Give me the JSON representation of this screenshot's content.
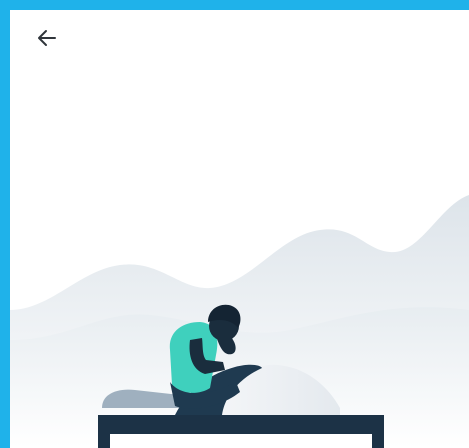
{
  "screen": {
    "frame_color": "#1fb2ea",
    "background_color": "#ffffff"
  },
  "toolbar": {
    "back_icon": "arrow-left-icon"
  },
  "illustration": {
    "subject": "person-sitting-on-bed-with-head-in-hand",
    "colors": {
      "skin": "#1a2d3d",
      "shirt": "#3fd0bd",
      "bed_frame": "#1c3246",
      "blanket_dark": "#1f3a50",
      "blanket_light": "#eef1f4",
      "mountains": "#dfe6ec",
      "pillow": "#9fb0bf"
    }
  }
}
